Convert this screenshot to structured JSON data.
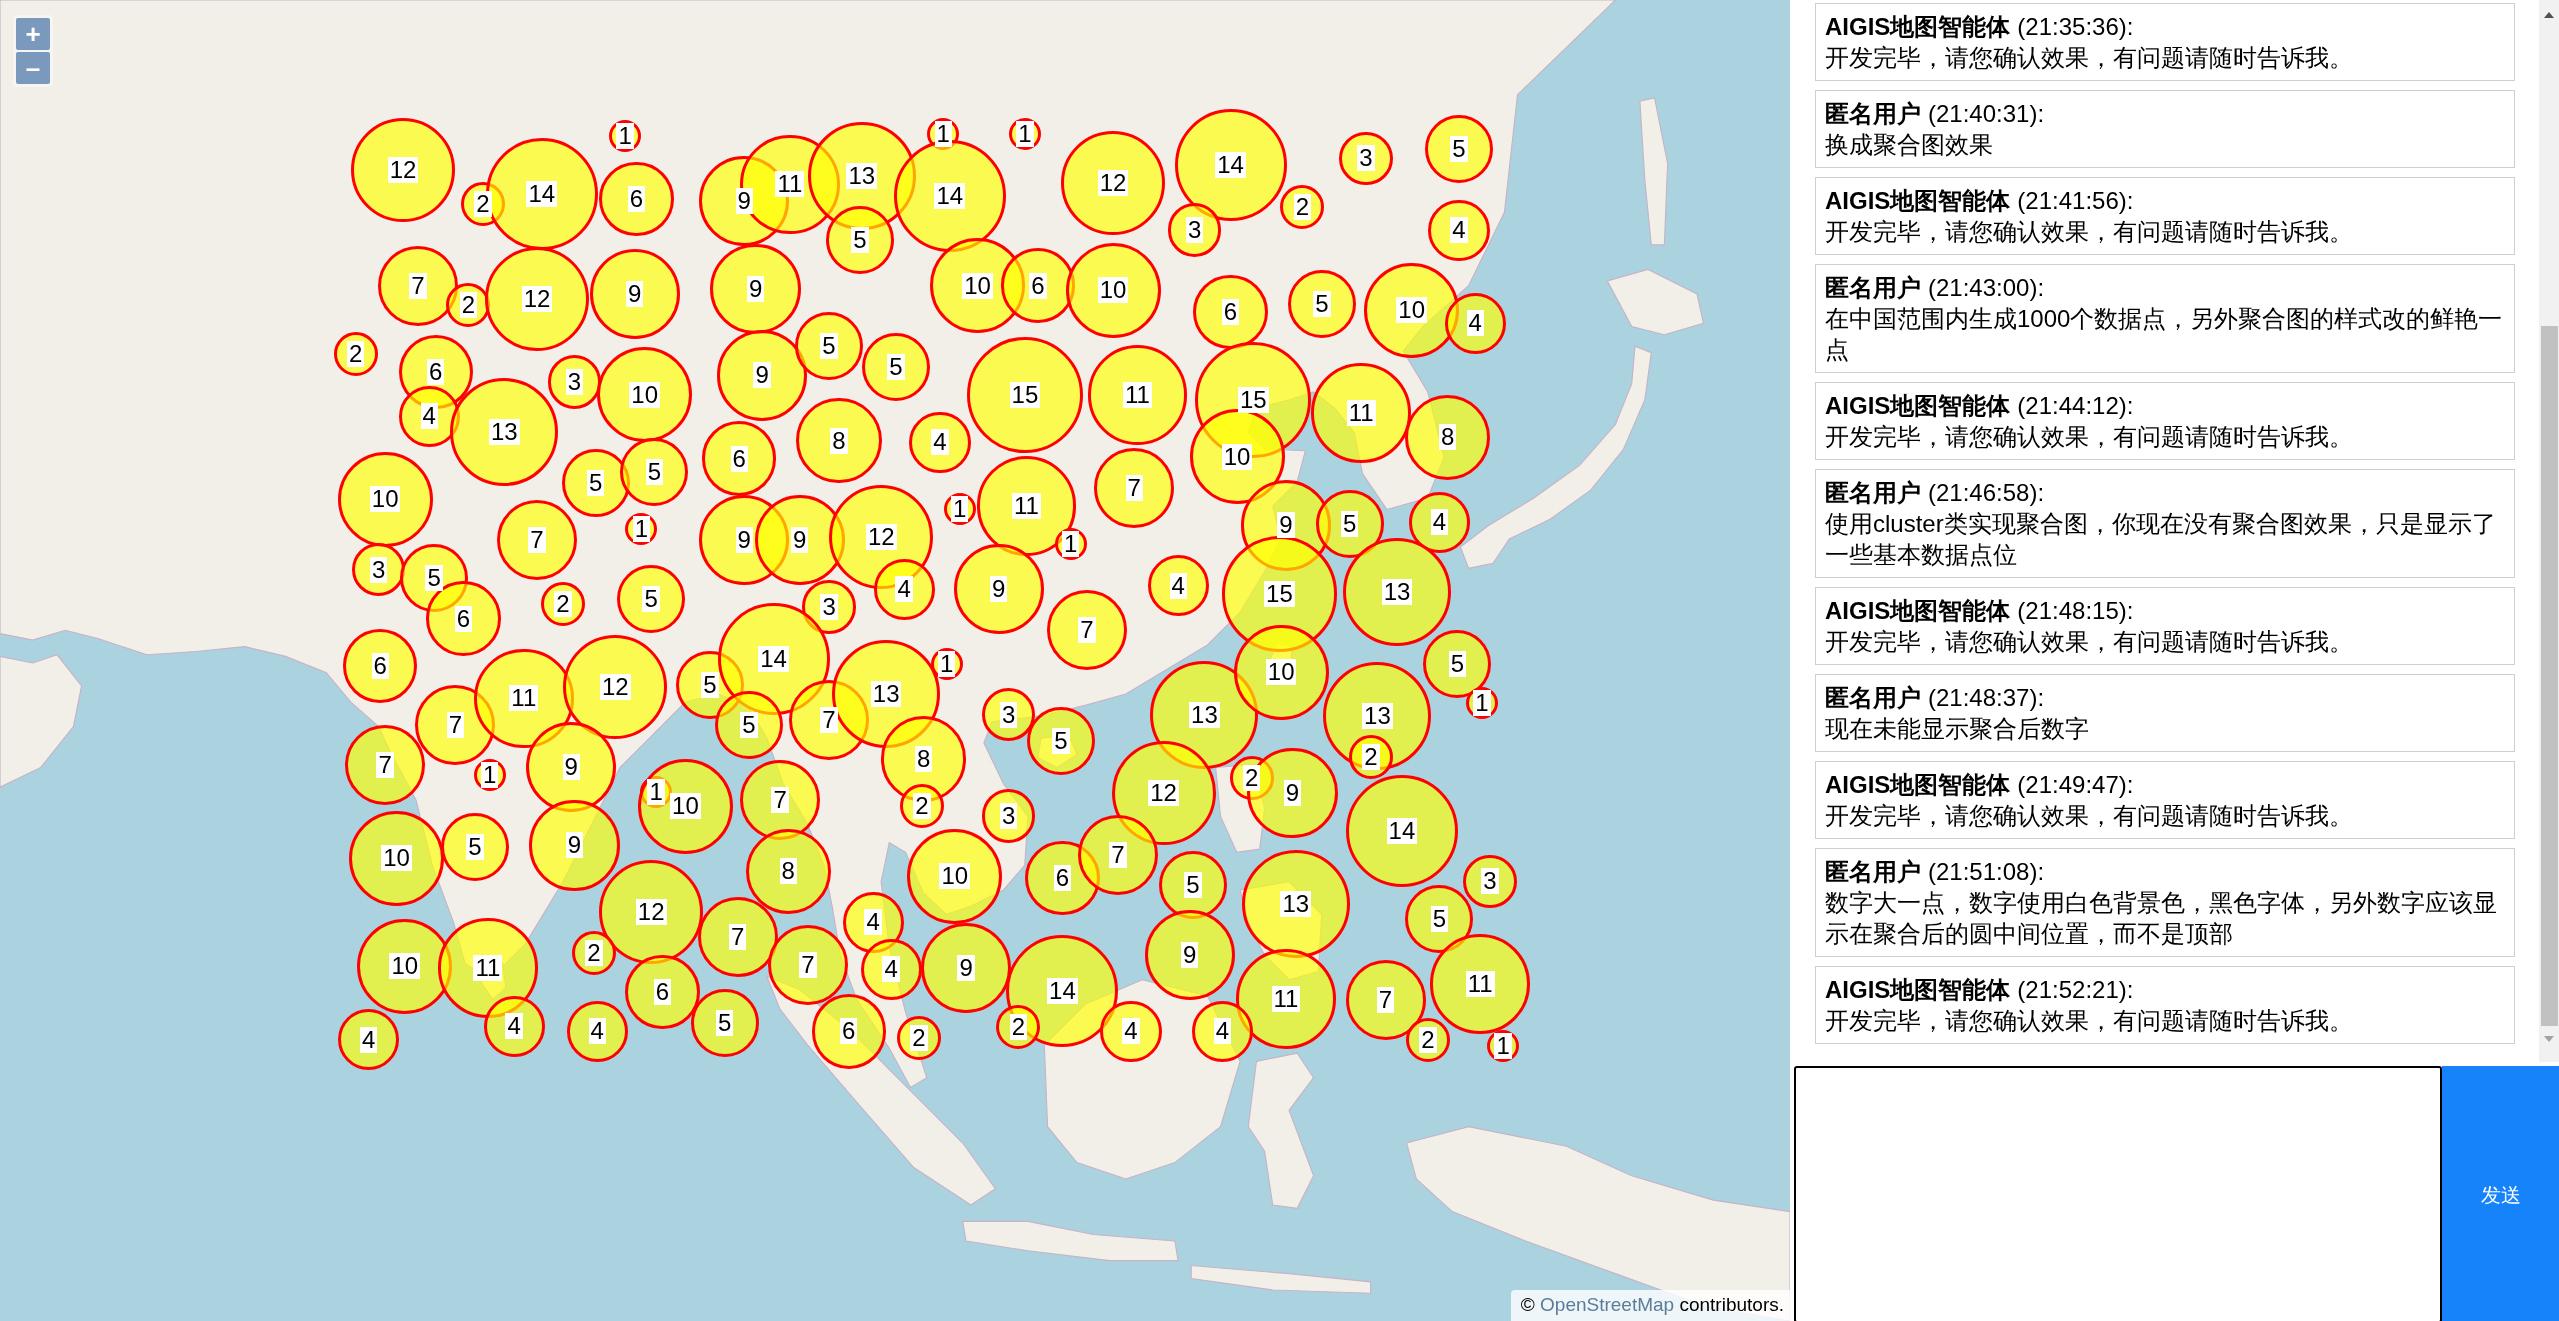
{
  "map": {
    "zoom_controls": [
      "+",
      "–"
    ],
    "clusters": [
      "12",
      "1",
      "1",
      "1",
      "2",
      "14",
      "6",
      "9",
      "11",
      "13",
      "5",
      "14",
      "12",
      "14",
      "3",
      "5",
      "3",
      "2",
      "4",
      "7",
      "2",
      "12",
      "9",
      "9",
      "10",
      "6",
      "10",
      "6",
      "5",
      "10",
      "4",
      "2",
      "6",
      "4",
      "13",
      "3",
      "10",
      "9",
      "5",
      "8",
      "5",
      "4",
      "15",
      "11",
      "15",
      "10",
      "11",
      "8",
      "10",
      "5",
      "5",
      "6",
      "7",
      "1",
      "9",
      "9",
      "12",
      "1",
      "11",
      "1",
      "7",
      "9",
      "5",
      "4",
      "3",
      "5",
      "6",
      "2",
      "5",
      "3",
      "4",
      "9",
      "4",
      "15",
      "13",
      "7",
      "6",
      "7",
      "11",
      "12",
      "5",
      "14",
      "5",
      "7",
      "13",
      "1",
      "3",
      "5",
      "13",
      "10",
      "13",
      "5",
      "1",
      "7",
      "1",
      "9",
      "1",
      "10",
      "7",
      "8",
      "2",
      "3",
      "12",
      "2",
      "9",
      "2",
      "14",
      "10",
      "5",
      "9",
      "12",
      "8",
      "4",
      "10",
      "6",
      "7",
      "5",
      "13",
      "5",
      "3",
      "10",
      "11",
      "2",
      "6",
      "7",
      "7",
      "4",
      "9",
      "14",
      "9",
      "11",
      "7",
      "11",
      "4",
      "4",
      "4",
      "5",
      "6",
      "2",
      "2",
      "4",
      "4",
      "2",
      "1"
    ],
    "attribution": {
      "prefix": "©",
      "link": "OpenStreetMap",
      "suffix": "contributors."
    }
  },
  "chat": {
    "messages": [
      {
        "sender": "AIGIS地图智能体",
        "time": "(21:35:36):",
        "text": "开发完毕，请您确认效果，有问题请随时告诉我。"
      },
      {
        "sender": "匿名用户",
        "time": "(21:40:31):",
        "text": "换成聚合图效果"
      },
      {
        "sender": "AIGIS地图智能体",
        "time": "(21:41:56):",
        "text": "开发完毕，请您确认效果，有问题请随时告诉我。"
      },
      {
        "sender": "匿名用户",
        "time": "(21:43:00):",
        "text": "在中国范围内生成1000个数据点，另外聚合图的样式改的鲜艳一点"
      },
      {
        "sender": "AIGIS地图智能体",
        "time": "(21:44:12):",
        "text": "开发完毕，请您确认效果，有问题请随时告诉我。"
      },
      {
        "sender": "匿名用户",
        "time": "(21:46:58):",
        "text": "使用cluster类实现聚合图，你现在没有聚合图效果，只是显示了一些基本数据点位"
      },
      {
        "sender": "AIGIS地图智能体",
        "time": "(21:48:15):",
        "text": "开发完毕，请您确认效果，有问题请随时告诉我。"
      },
      {
        "sender": "匿名用户",
        "time": "(21:48:37):",
        "text": "现在未能显示聚合后数字"
      },
      {
        "sender": "AIGIS地图智能体",
        "time": "(21:49:47):",
        "text": "开发完毕，请您确认效果，有问题请随时告诉我。"
      },
      {
        "sender": "匿名用户",
        "time": "(21:51:08):",
        "text": "数字大一点，数字使用白色背景色，黑色字体，另外数字应该显示在聚合后的圆中间位置，而不是顶部"
      },
      {
        "sender": "AIGIS地图智能体",
        "time": "(21:52:21):",
        "text": "开发完毕，请您确认效果，有问题请随时告诉我。"
      }
    ],
    "send_button": "发送"
  }
}
